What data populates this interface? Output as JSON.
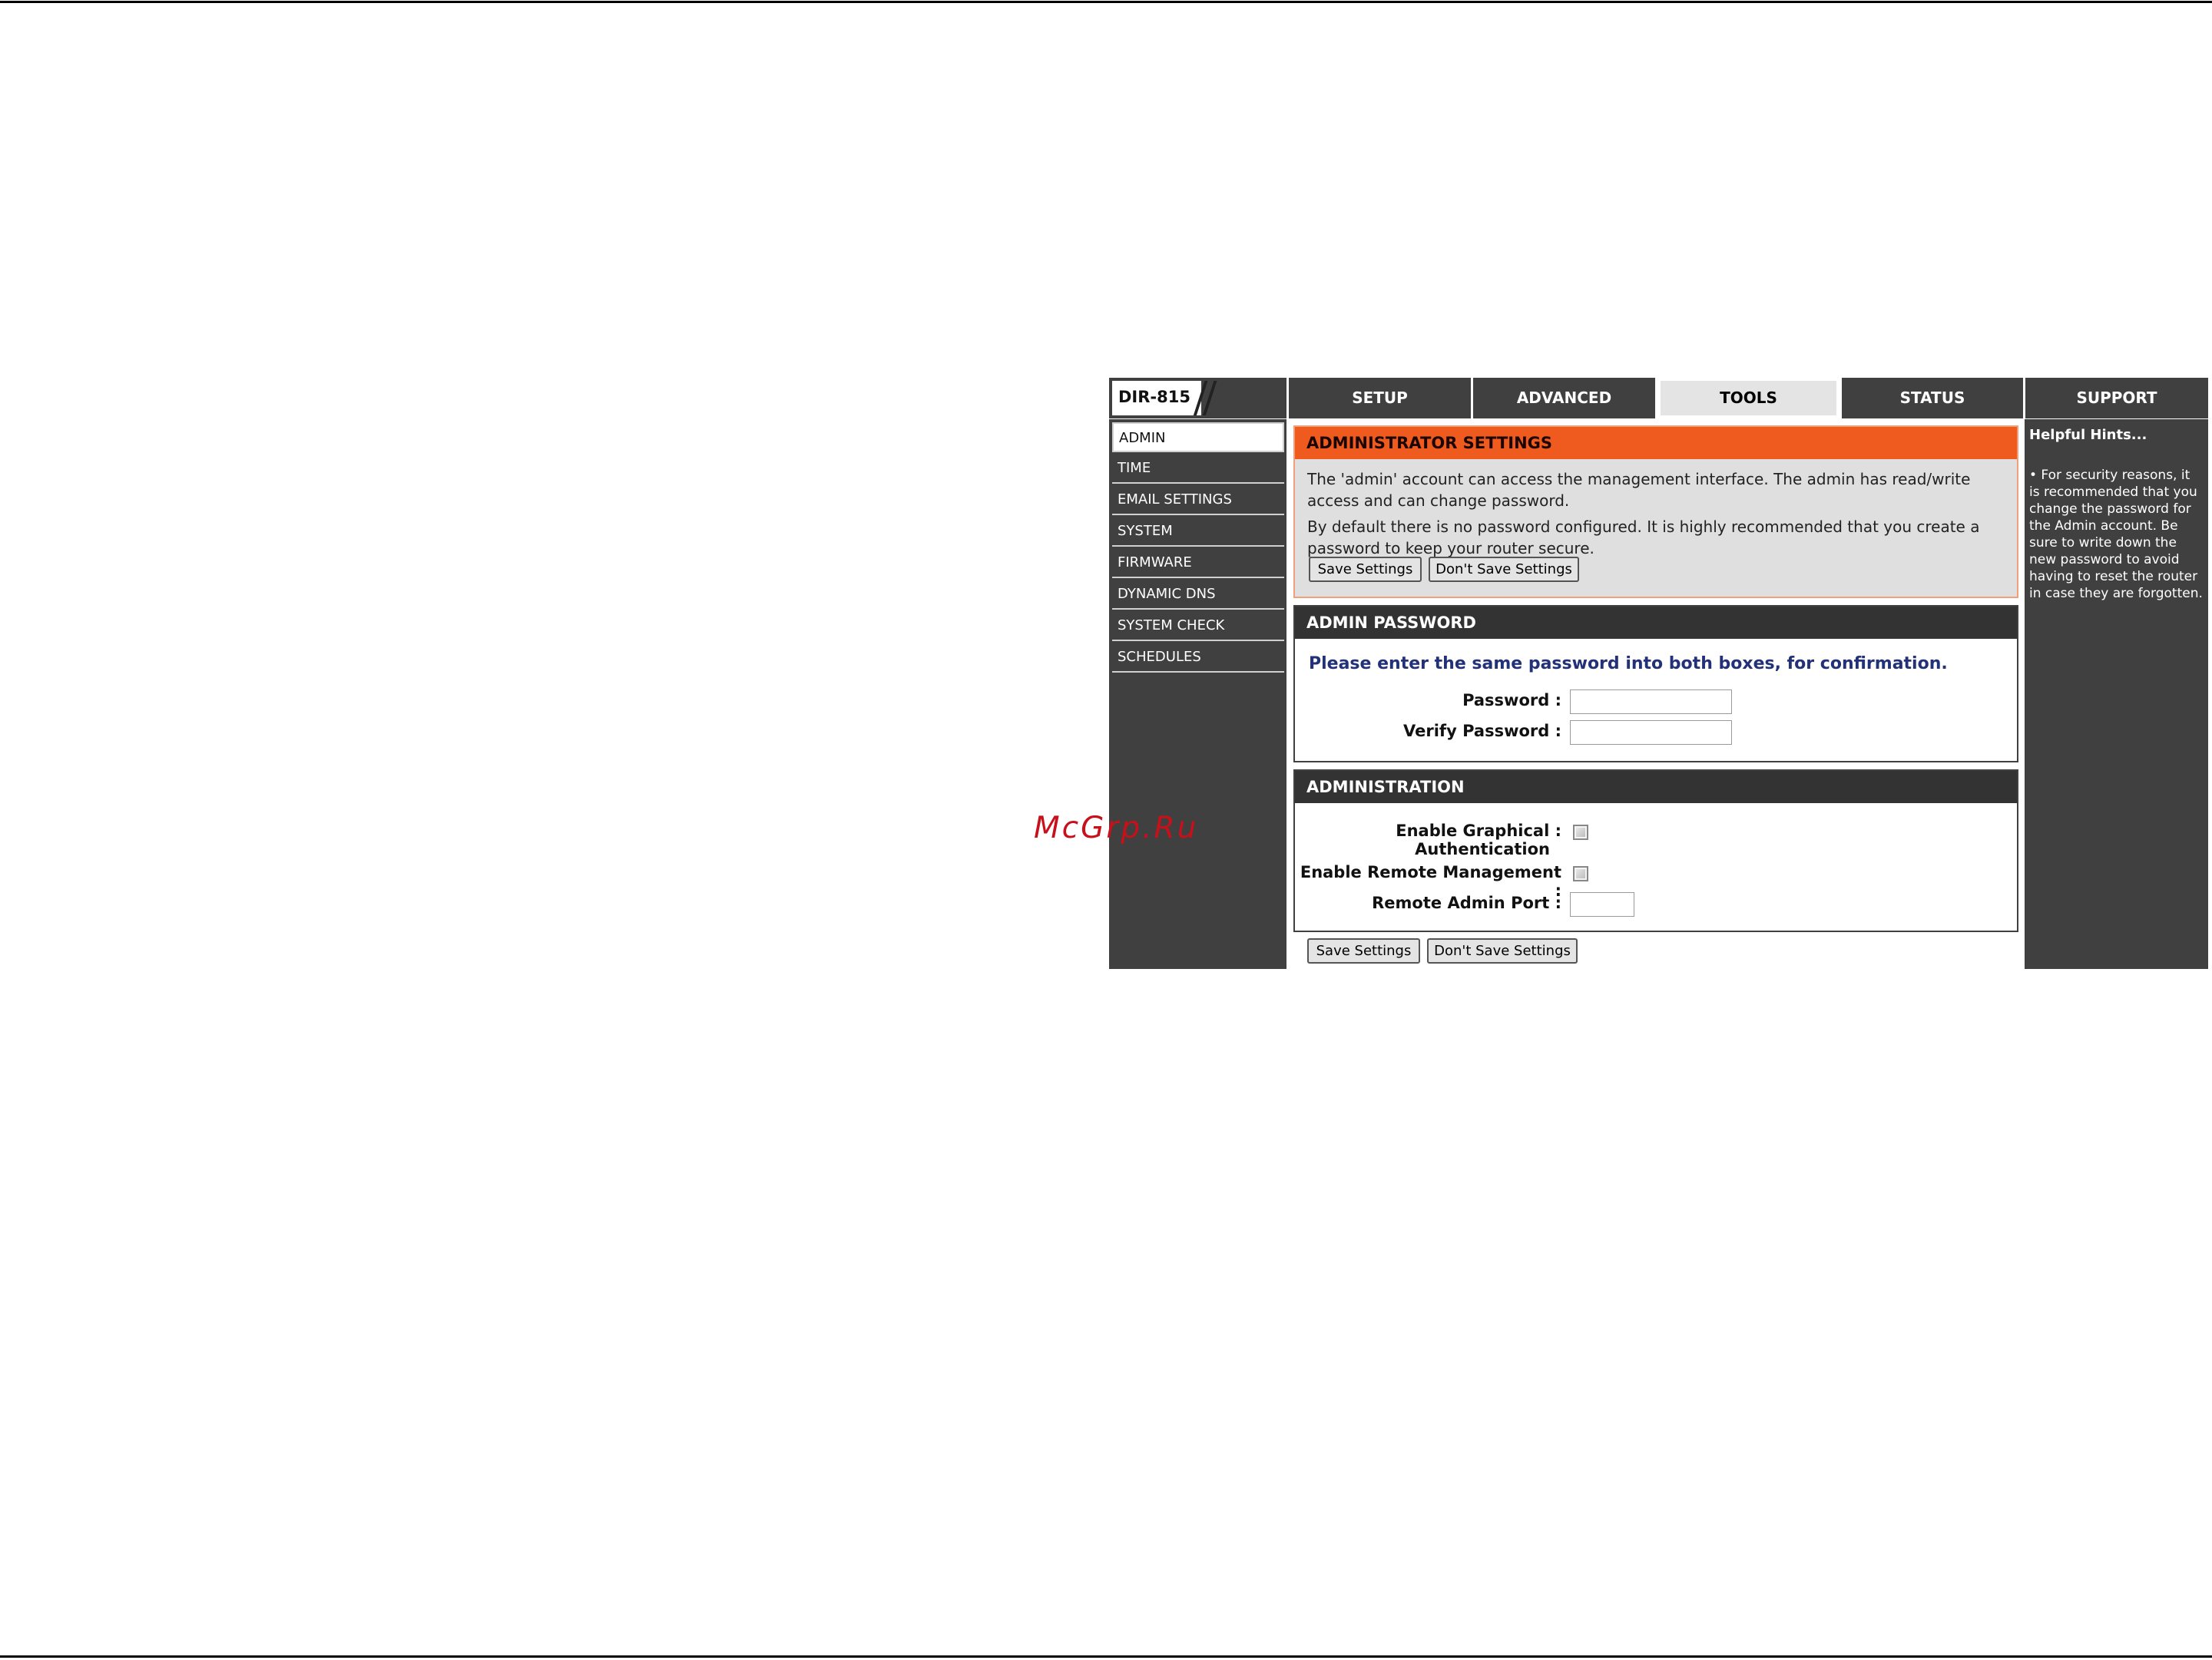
{
  "watermark": "McGrp.Ru",
  "brand": {
    "model": "DIR-815"
  },
  "tabs": [
    {
      "label": "SETUP",
      "active": false
    },
    {
      "label": "ADVANCED",
      "active": false
    },
    {
      "label": "TOOLS",
      "active": true
    },
    {
      "label": "STATUS",
      "active": false
    },
    {
      "label": "SUPPORT",
      "active": false
    }
  ],
  "sidebar": {
    "items": [
      {
        "label": "ADMIN",
        "active": true
      },
      {
        "label": "TIME"
      },
      {
        "label": "EMAIL SETTINGS"
      },
      {
        "label": "SYSTEM"
      },
      {
        "label": "FIRMWARE"
      },
      {
        "label": "DYNAMIC DNS"
      },
      {
        "label": "SYSTEM CHECK"
      },
      {
        "label": "SCHEDULES"
      }
    ]
  },
  "admin_settings": {
    "title": "ADMINISTRATOR SETTINGS",
    "para1": "The 'admin' account can access the management interface. The admin has read/write access and can change password.",
    "para2": "By default there is no password configured. It is highly recommended that you create a password to keep your router secure.",
    "save_label": "Save Settings",
    "dont_save_label": "Don't Save Settings"
  },
  "admin_password": {
    "title": "ADMIN PASSWORD",
    "message": "Please enter the same password into both boxes, for confirmation.",
    "password_label": "Password :",
    "verify_label": "Verify Password :",
    "password_value": "",
    "verify_value": ""
  },
  "administration": {
    "title": "ADMINISTRATION",
    "graphical_auth_label_line1": "Enable Graphical :",
    "graphical_auth_label_line2": "Authentication",
    "graphical_auth_checked": false,
    "remote_mgmt_label": "Enable Remote Management :",
    "remote_mgmt_checked": false,
    "remote_port_label": "Remote Admin Port :",
    "remote_port_value": ""
  },
  "footer_buttons": {
    "save_label": "Save Settings",
    "dont_save_label": "Don't Save Settings"
  },
  "hints": {
    "title": "Helpful Hints...",
    "text": "• For security reasons, it is recommended that you change the password for the Admin account. Be sure to write down the new password to avoid having to reset the router in case they are forgotten."
  },
  "colors": {
    "nav_dark": "#404040",
    "section_orange": "#ef5a1f",
    "confirm_blue": "#233278"
  }
}
